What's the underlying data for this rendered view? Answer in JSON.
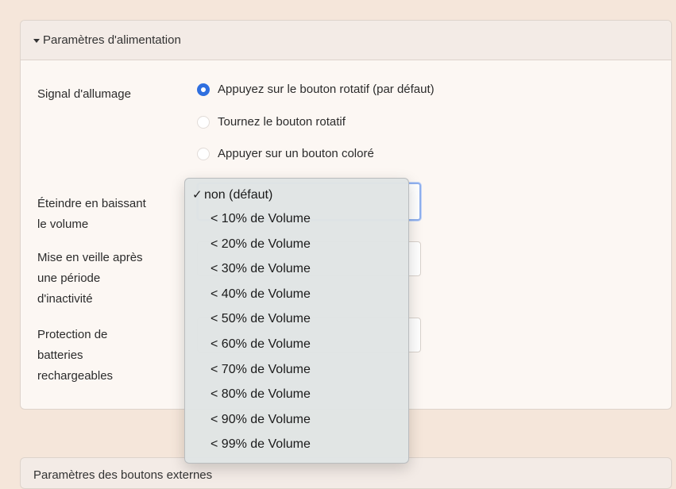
{
  "panel": {
    "title": "Paramètres d'alimentation"
  },
  "power_on_signal": {
    "label": "Signal d'allumage",
    "options": [
      {
        "label": "Appuyez sur le bouton rotatif (par défaut)",
        "selected": true
      },
      {
        "label": "Tournez le bouton rotatif",
        "selected": false
      },
      {
        "label": "Appuyer sur un bouton coloré",
        "selected": false
      }
    ]
  },
  "volume_off": {
    "label_line1": "Éteindre en baissant",
    "label_line2": "le volume",
    "dropdown_open": true,
    "options": [
      "non (défaut)",
      "< 10% de Volume",
      "< 20% de Volume",
      "< 30% de Volume",
      "< 40% de Volume",
      "< 50% de Volume",
      "< 60% de Volume",
      "< 70% de Volume",
      "< 80% de Volume",
      "< 90% de Volume",
      "< 99% de Volume"
    ],
    "selected_index": 0,
    "check_glyph": "✓"
  },
  "sleep": {
    "label_line1": "Mise en veille après",
    "label_line2": "une période",
    "label_line3": "d'inactivité"
  },
  "battery": {
    "label_line1": "Protection de",
    "label_line2": "batteries",
    "label_line3": "rechargeables"
  },
  "section2": {
    "title": "Paramètres des boutons externes"
  },
  "colors": {
    "background": "#f5e6da",
    "accent": "#2f6fdf",
    "panel": "#fcf7f3"
  }
}
